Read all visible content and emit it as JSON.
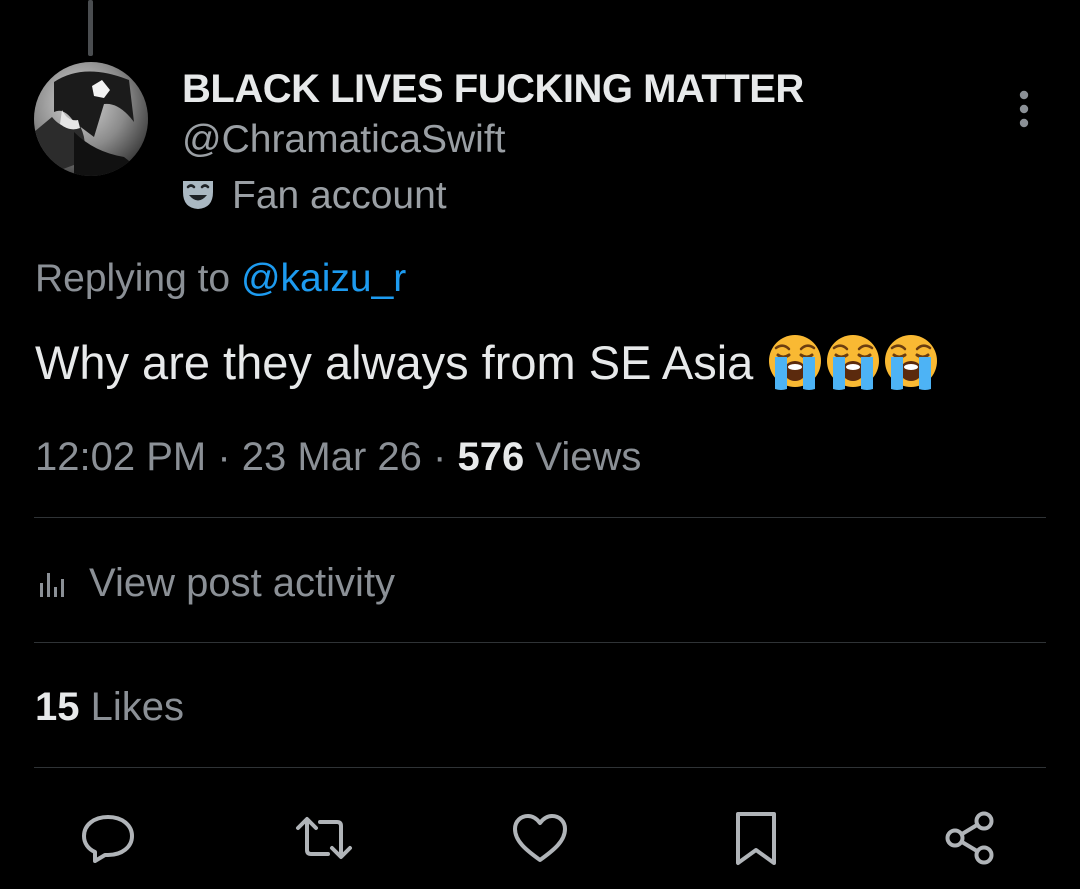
{
  "author": {
    "display_name": "BLACK LIVES FUCKING MATTER",
    "handle": "@ChramaticaSwift",
    "label_icon": "theater-mask-icon",
    "label": "Fan account"
  },
  "reply": {
    "prefix": "Replying to",
    "mention": "@kaizu_r"
  },
  "post": {
    "text": "Why are they always from SE Asia",
    "emoji": [
      "loudly-crying-face",
      "loudly-crying-face",
      "loudly-crying-face"
    ]
  },
  "meta": {
    "time": "12:02 PM",
    "separator": "·",
    "date": "23 Mar 26",
    "views_count": "576",
    "views_label": "Views"
  },
  "activity": {
    "icon": "bar-chart-icon",
    "label": "View post activity"
  },
  "likes": {
    "count": "15",
    "label": "Likes"
  },
  "actions": [
    {
      "icon": "reply-icon"
    },
    {
      "icon": "repost-icon"
    },
    {
      "icon": "like-icon"
    },
    {
      "icon": "bookmark-icon"
    },
    {
      "icon": "share-icon"
    }
  ],
  "colors": {
    "background": "#000000",
    "primary_text": "#e7e9ea",
    "secondary_text": "#8b9096",
    "link": "#1d9bf0",
    "divider": "#2f3336",
    "icon": "#b0b4b8"
  }
}
